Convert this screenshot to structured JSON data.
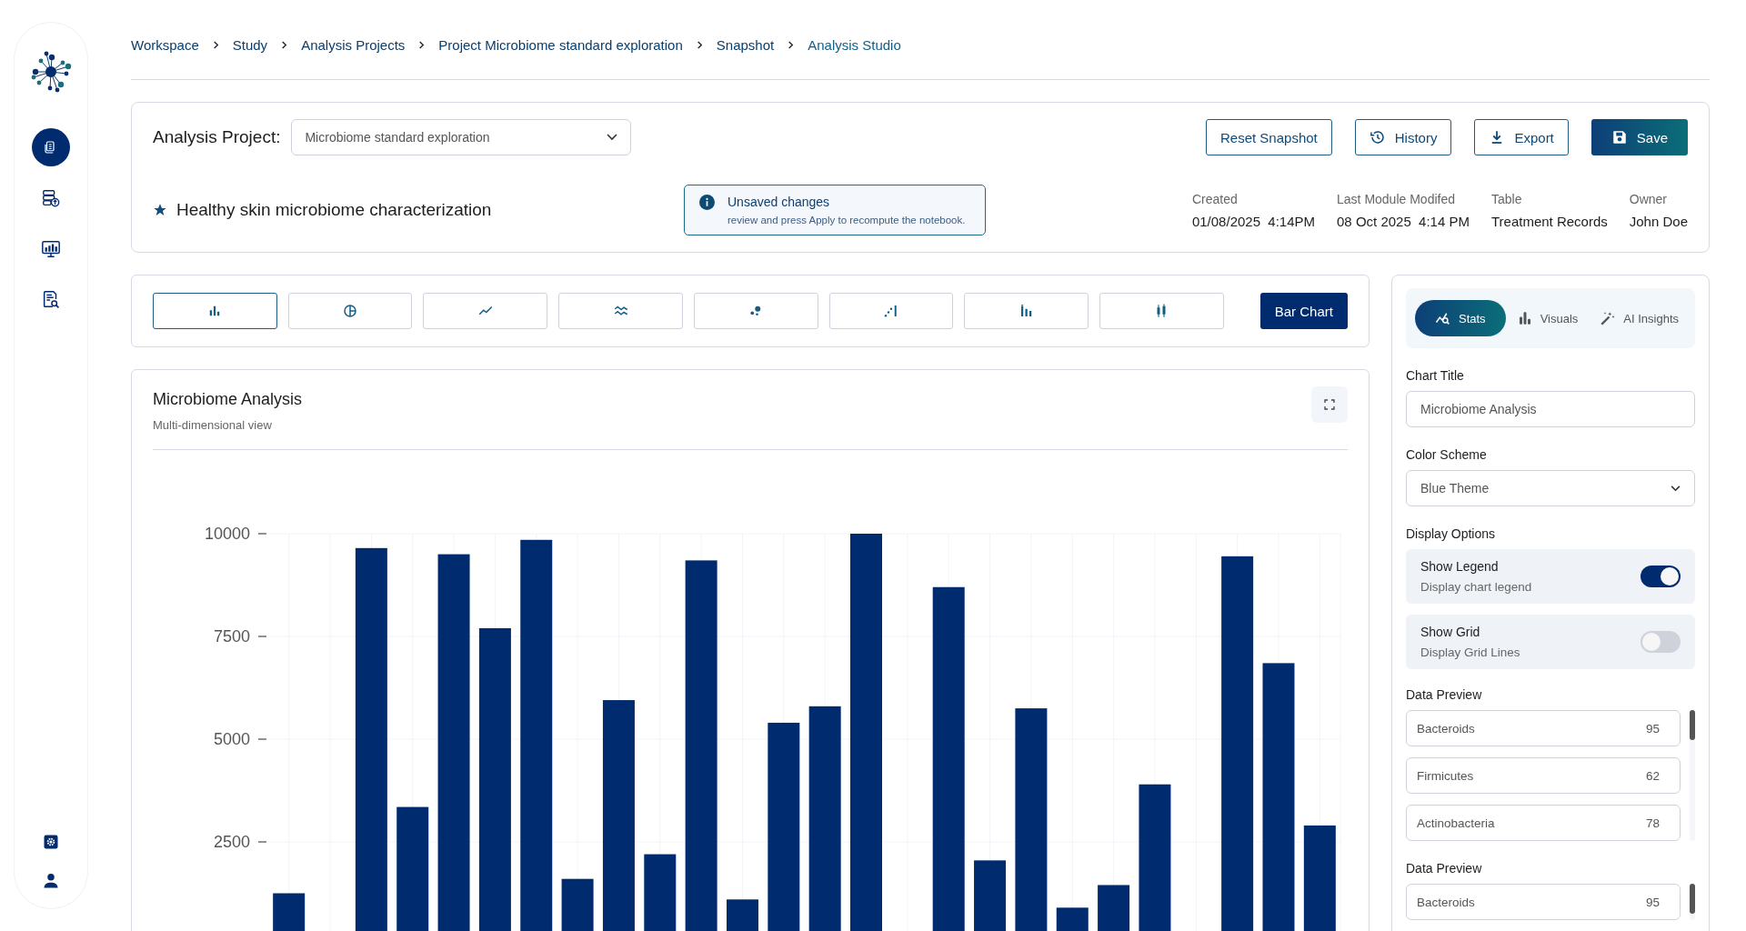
{
  "sidebar": {
    "items": [
      {
        "kind": "documents",
        "selected": true
      },
      {
        "kind": "database",
        "selected": false
      },
      {
        "kind": "monitor",
        "selected": false
      },
      {
        "kind": "report",
        "selected": false
      }
    ],
    "bottom": [
      {
        "kind": "settings"
      },
      {
        "kind": "user"
      }
    ]
  },
  "breadcrumb": [
    "Workspace",
    "Study",
    "Analysis Projects",
    "Project Microbiome standard exploration",
    "Snapshot",
    "Analysis Studio"
  ],
  "project": {
    "label": "Analysis Project:",
    "value": "Microbiome standard exploration",
    "buttons": [
      {
        "label": "Reset Snapshot",
        "kind": "plain"
      },
      {
        "label": "History",
        "kind": "history"
      },
      {
        "label": "Export",
        "kind": "export"
      },
      {
        "label": "Save",
        "kind": "save"
      }
    ],
    "title": "Healthy skin microbiome characterization",
    "notice": {
      "title": "Unsaved changes",
      "text": "review and press Apply to recompute the notebook."
    },
    "meta": [
      {
        "label": "Created",
        "value": "01/08/2025  4:14PM"
      },
      {
        "label": "Last Module Modifed",
        "value": "08 Oct 2025  4:14 PM"
      },
      {
        "label": "Table",
        "value": "Treatment Records"
      },
      {
        "label": "Owner",
        "value": "John Doe"
      }
    ]
  },
  "chart_types": [
    {
      "kind": "bar",
      "selected": true
    },
    {
      "kind": "pie",
      "selected": false
    },
    {
      "kind": "line",
      "selected": false
    },
    {
      "kind": "wave",
      "selected": false
    },
    {
      "kind": "scatter",
      "selected": false
    },
    {
      "kind": "step",
      "selected": false
    },
    {
      "kind": "grouped",
      "selected": false
    },
    {
      "kind": "candle",
      "selected": false
    }
  ],
  "chart_type_label": "Bar Chart",
  "chart_card": {
    "title": "Microbiome Analysis",
    "subtitle": "Multi-dimensional view",
    "chart_data": {
      "type": "bar",
      "grid": true,
      "ylim": [
        0,
        10000
      ],
      "yticks": [
        2500,
        5000,
        7500,
        10000
      ],
      "values": [
        1250,
        null,
        9650,
        3350,
        9500,
        7700,
        9850,
        1600,
        5950,
        2200,
        9350,
        1100,
        5400,
        5800,
        10000,
        null,
        8700,
        2050,
        5750,
        900,
        1450,
        3900,
        null,
        9450,
        6850,
        2900
      ]
    }
  },
  "panel": {
    "tabs": [
      {
        "label": "Stats",
        "kind": "stats",
        "selected": true
      },
      {
        "label": "Visuals",
        "kind": "visuals",
        "selected": false
      },
      {
        "label": "AI Insights",
        "kind": "ai",
        "selected": false
      }
    ],
    "chart_title": {
      "label": "Chart Title",
      "value": "Microbiome Analysis"
    },
    "color_scheme": {
      "label": "Color Scheme",
      "value": "Blue Theme"
    },
    "display_options": {
      "label": "Display Options",
      "options": [
        {
          "title": "Show Legend",
          "description": "Display chart legend",
          "on": true
        },
        {
          "title": "Show Grid",
          "description": "Display Grid Lines",
          "on": false
        }
      ]
    },
    "previews": [
      {
        "label": "Data Preview",
        "rows": [
          {
            "name": "Bacteroids",
            "value": "95"
          },
          {
            "name": "Firmicutes",
            "value": "62"
          },
          {
            "name": "Actinobacteria",
            "value": "78"
          }
        ]
      },
      {
        "label": "Data Preview",
        "rows": [
          {
            "name": "Bacteroids",
            "value": "95"
          }
        ]
      }
    ]
  }
}
